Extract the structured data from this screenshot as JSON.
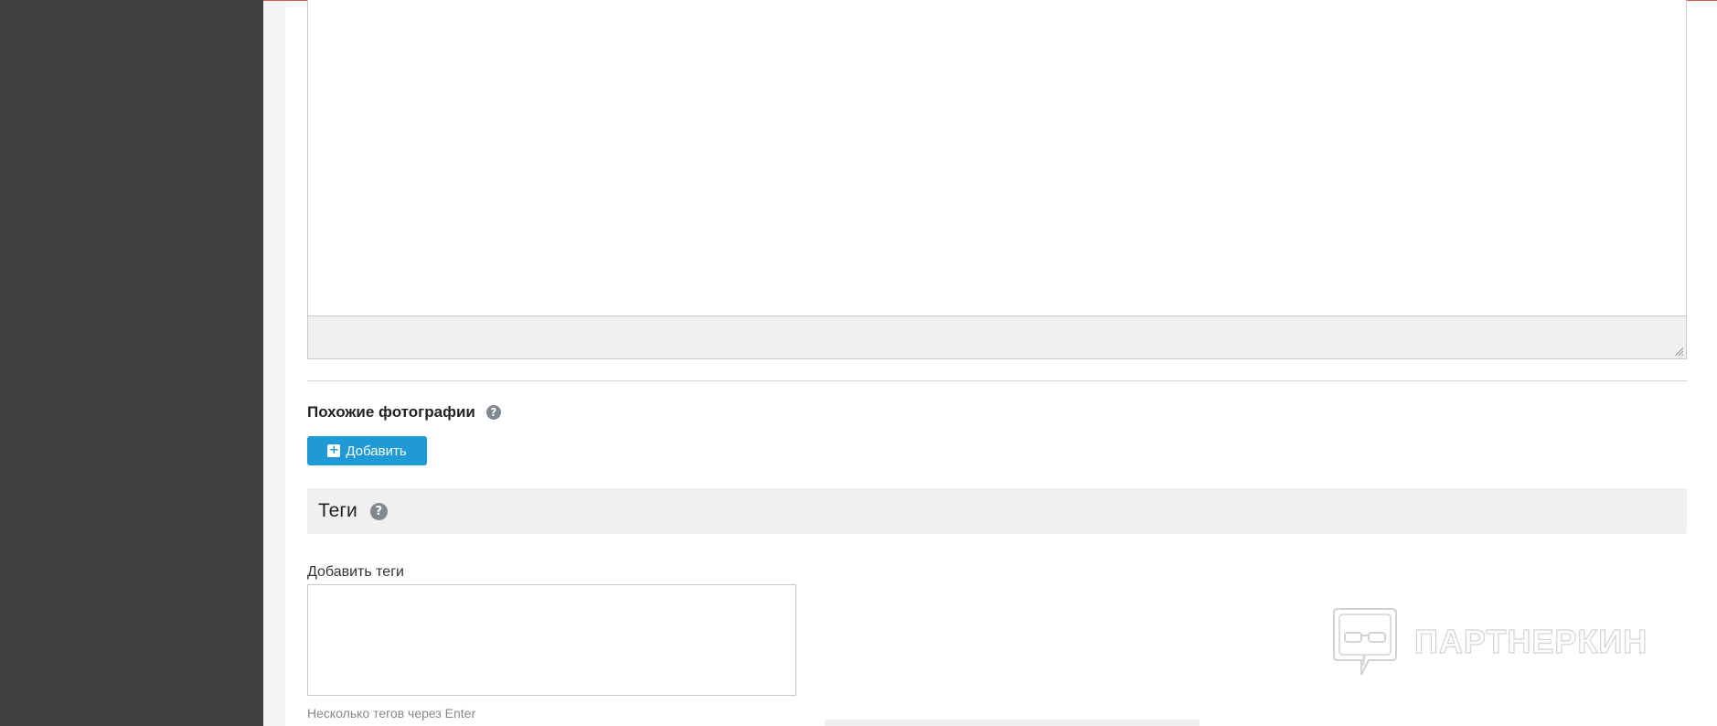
{
  "similar_photos": {
    "label": "Похожие фотографии",
    "help_icon": "?",
    "add_button_label": "Добавить",
    "add_button_icon": "+"
  },
  "tags": {
    "section_title": "Теги",
    "help_icon": "?",
    "add_label": "Добавить теги",
    "input_value": "",
    "hint": "Несколько тегов через Enter"
  },
  "watermark": {
    "text": "ПАРТНЕРКИН"
  },
  "colors": {
    "sidebar": "#404040",
    "accent_button": "#1f9ad6",
    "top_line": "#d9534f"
  }
}
